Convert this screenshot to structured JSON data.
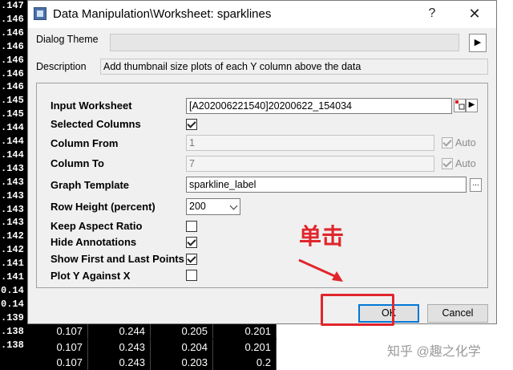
{
  "background_sheet": {
    "left_values": [
      ".147",
      ".146",
      ".146",
      ".146",
      ".146",
      ".146",
      ".146",
      ".145",
      ".145",
      ".144",
      ".144",
      ".144",
      ".143",
      ".143",
      ".143",
      ".143",
      ".143",
      ".142",
      ".142",
      ".141",
      ".141",
      "0.14",
      "0.14",
      ".139",
      ".138",
      ".138"
    ],
    "rows": [
      [
        "0.107",
        "0.244",
        "0.205",
        "0.201"
      ],
      [
        "0.107",
        "0.243",
        "0.204",
        "0.201"
      ],
      [
        "0.107",
        "0.243",
        "0.203",
        "0.2"
      ]
    ]
  },
  "dialog": {
    "title": "Data Manipulation\\Worksheet: sparklines",
    "help": "?",
    "close": "✕",
    "theme_label": "Dialog Theme",
    "theme_value": "",
    "theme_btn": "▶",
    "description_label": "Description",
    "description": "Add thumbnail size plots of each Y column above the data",
    "fields": {
      "input_worksheet": {
        "label": "Input Worksheet",
        "value": "[A202006221540]20200622_154034"
      },
      "selected_columns": {
        "label": "Selected Columns",
        "checked": true
      },
      "column_from": {
        "label": "Column From",
        "value": "1",
        "auto_label": "Auto",
        "auto_checked": true
      },
      "column_to": {
        "label": "Column To",
        "value": "7",
        "auto_label": "Auto",
        "auto_checked": true
      },
      "graph_template": {
        "label": "Graph Template",
        "value": "sparkline_label",
        "browse": "..."
      },
      "row_height": {
        "label": "Row Height (percent)",
        "value": "200"
      },
      "keep_aspect": {
        "label": "Keep Aspect Ratio",
        "checked": false
      },
      "hide_annotations": {
        "label": "Hide Annotations",
        "checked": true
      },
      "show_first_last": {
        "label": "Show First and Last Points",
        "checked": true
      },
      "plot_y_against_x": {
        "label": "Plot Y Against X",
        "checked": false
      }
    },
    "ok_label": "OK",
    "cancel_label": "Cancel"
  },
  "annotation": {
    "text": "单击"
  },
  "watermark": "知乎 @趣之化学",
  "colors": {
    "highlight": "#e0262c",
    "default_button": "#0078d7"
  }
}
